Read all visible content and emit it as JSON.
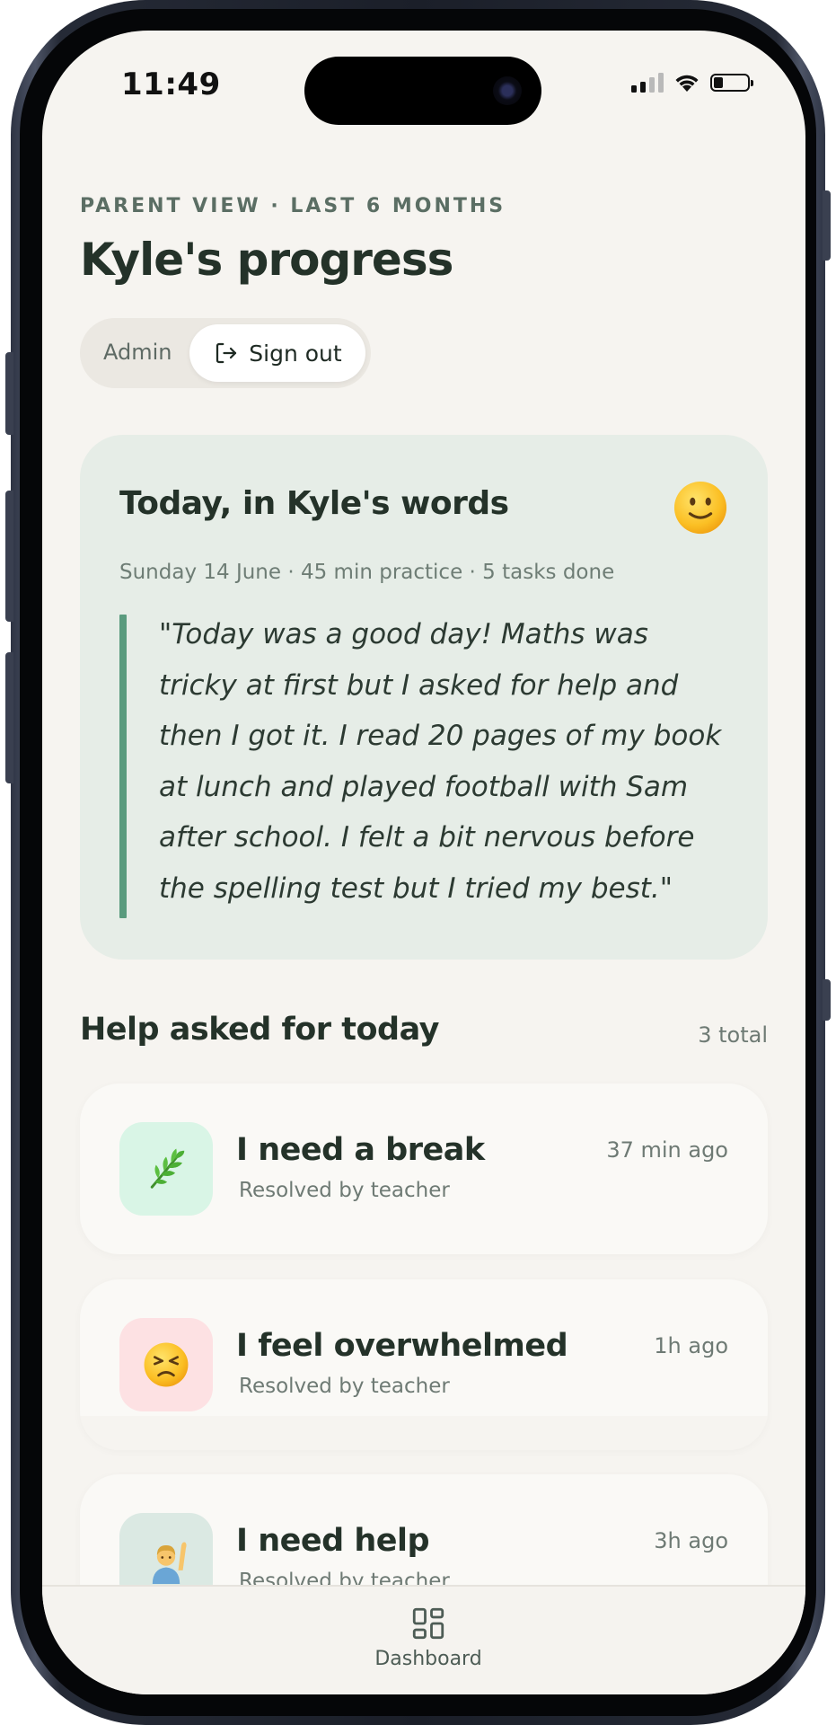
{
  "status_bar": {
    "time": "11:49"
  },
  "header": {
    "eyebrow": "PARENT VIEW · LAST 6 MONTHS",
    "title": "Kyle's progress",
    "role_label": "Admin",
    "signout_label": "Sign out"
  },
  "today_card": {
    "title": "Today, in Kyle's words",
    "mood_icon": "slightly-smiling-face-icon",
    "meta": "Sunday 14 June · 45 min practice · 5 tasks done",
    "quote": "\"Today was a good day! Maths was tricky at first but I asked for help and then I got it. I read 20 pages of my book at lunch and played football with Sam after school. I felt a bit nervous before the spelling test but I tried my best.\""
  },
  "help_section": {
    "title": "Help asked for today",
    "count": "3 total",
    "items": [
      {
        "icon": "herb-icon",
        "icon_bg": "#d9f5e6",
        "title": "I need a break",
        "status": "Resolved by teacher",
        "time": "37 min ago"
      },
      {
        "icon": "persevering-face-icon",
        "icon_bg": "#fde1e3",
        "title": "I feel overwhelmed",
        "status": "Resolved by teacher",
        "time": "1h ago"
      },
      {
        "icon": "person-raising-hand-icon",
        "icon_bg": "#dbe9e3",
        "title": "I need help",
        "status": "Resolved by teacher",
        "time": "3h ago"
      }
    ]
  },
  "tab_bar": {
    "dashboard_label": "Dashboard"
  },
  "colors": {
    "background": "#f6f4f0",
    "accent_green": "#5a9b7e",
    "card_green": "#e6ede7",
    "text_dark": "#243229"
  }
}
